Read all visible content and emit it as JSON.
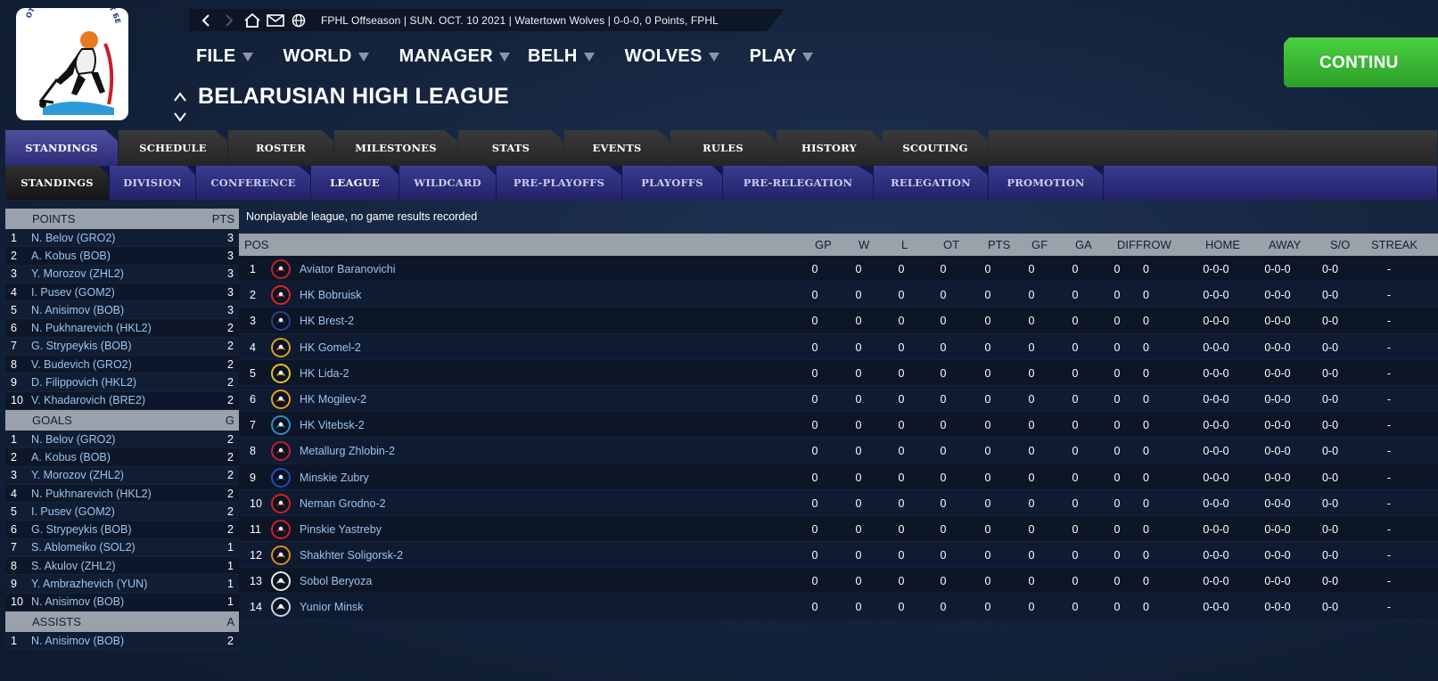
{
  "header": {
    "status_text": "FPHL Offseason | SUN. OCT. 10 2021 | Watertown Wolves | 0-0-0, 0 Points, FPHL",
    "league_title": "BELARUSIAN HIGH LEAGUE",
    "continue_label": "CONTINU",
    "menu": [
      "FILE",
      "WORLD",
      "MANAGER",
      "BELH",
      "WOLVES",
      "PLAY"
    ],
    "logo_text": "ОТКРЫТЫЙ ЧЕМПИОНАТ БЕЛАРУСИ"
  },
  "tabs_primary": [
    "STANDINGS",
    "SCHEDULE",
    "ROSTER",
    "MILESTONES",
    "STATS",
    "EVENTS",
    "RULES",
    "HISTORY",
    "SCOUTING"
  ],
  "tabs_secondary": [
    "STANDINGS",
    "DIVISION",
    "CONFERENCE",
    "LEAGUE",
    "WILDCARD",
    "PRE-PLAYOFFS",
    "PLAYOFFS",
    "PRE-RELEGATION",
    "RELEGATION",
    "PROMOTION"
  ],
  "leaders": {
    "points": {
      "title": "POINTS",
      "stat": "PTS",
      "rows": [
        {
          "rank": "1",
          "name": "N. Belov (GRO2)",
          "value": "3"
        },
        {
          "rank": "2",
          "name": "A. Kobus (BOB)",
          "value": "3"
        },
        {
          "rank": "3",
          "name": "Y. Morozov (ZHL2)",
          "value": "3"
        },
        {
          "rank": "4",
          "name": "I. Pusev (GOM2)",
          "value": "3"
        },
        {
          "rank": "5",
          "name": "N. Anisimov (BOB)",
          "value": "3"
        },
        {
          "rank": "6",
          "name": "N. Pukhnarevich (HKL2)",
          "value": "2"
        },
        {
          "rank": "7",
          "name": "G. Strypeykis (BOB)",
          "value": "2"
        },
        {
          "rank": "8",
          "name": "V. Budevich (GRO2)",
          "value": "2"
        },
        {
          "rank": "9",
          "name": "D. Filippovich (HKL2)",
          "value": "2"
        },
        {
          "rank": "10",
          "name": "V. Khadarovich (BRE2)",
          "value": "2"
        }
      ]
    },
    "goals": {
      "title": "GOALS",
      "stat": "G",
      "rows": [
        {
          "rank": "1",
          "name": "N. Belov (GRO2)",
          "value": "2"
        },
        {
          "rank": "2",
          "name": "A. Kobus (BOB)",
          "value": "2"
        },
        {
          "rank": "3",
          "name": "Y. Morozov (ZHL2)",
          "value": "2"
        },
        {
          "rank": "4",
          "name": "N. Pukhnarevich (HKL2)",
          "value": "2"
        },
        {
          "rank": "5",
          "name": "I. Pusev (GOM2)",
          "value": "2"
        },
        {
          "rank": "6",
          "name": "G. Strypeykis (BOB)",
          "value": "2"
        },
        {
          "rank": "7",
          "name": "S. Ablomeiko (SOL2)",
          "value": "1"
        },
        {
          "rank": "8",
          "name": "S. Akulov (ZHL2)",
          "value": "1"
        },
        {
          "rank": "9",
          "name": "Y. Ambrazhevich (YUN)",
          "value": "1"
        },
        {
          "rank": "10",
          "name": "N. Anisimov (BOB)",
          "value": "1"
        }
      ]
    },
    "assists": {
      "title": "ASSISTS",
      "stat": "A",
      "rows": [
        {
          "rank": "1",
          "name": "N. Anisimov (BOB)",
          "value": "2"
        }
      ]
    }
  },
  "standings": {
    "notice": "Nonplayable league, no game results recorded",
    "columns": [
      "POS",
      "GP",
      "W",
      "L",
      "OT",
      "PTS",
      "GF",
      "GA",
      "DIFF",
      "ROW",
      "HOME",
      "AWAY",
      "S/O",
      "STREAK"
    ],
    "rows": [
      {
        "pos": "1",
        "team": "Aviator Baranovichi",
        "logo": "red-star-plane",
        "color": "#c8202a"
      },
      {
        "pos": "2",
        "team": "HK Bobruisk",
        "logo": "beaver",
        "color": "#d8282a"
      },
      {
        "pos": "3",
        "team": "HK Brest-2",
        "logo": "bison",
        "color": "#2a3f8f"
      },
      {
        "pos": "4",
        "team": "HK Gomel-2",
        "logo": "wolf-head",
        "color": "#e0a020"
      },
      {
        "pos": "5",
        "team": "HK Lida-2",
        "logo": "shield-l",
        "color": "#e8c020"
      },
      {
        "pos": "6",
        "team": "HK Mogilev-2",
        "logo": "lion",
        "color": "#e8a020"
      },
      {
        "pos": "7",
        "team": "HK Vitebsk-2",
        "logo": "shark",
        "color": "#2a8fd0"
      },
      {
        "pos": "8",
        "team": "Metallurg Zhlobin-2",
        "logo": "wolf-crest",
        "color": "#c02030"
      },
      {
        "pos": "9",
        "team": "Minskie Zubry",
        "logo": "bison-circle",
        "color": "#1e4fb8"
      },
      {
        "pos": "10",
        "team": "Neman Grodno-2",
        "logo": "h-circle",
        "color": "#d02028"
      },
      {
        "pos": "11",
        "team": "Pinskie Yastreby",
        "logo": "hawk-wings",
        "color": "#d02030"
      },
      {
        "pos": "12",
        "team": "Shakhter Soligorsk-2",
        "logo": "miner",
        "color": "#e08a20"
      },
      {
        "pos": "13",
        "team": "Sobol Beryoza",
        "logo": "sable-circle",
        "color": "#e8e8e8"
      },
      {
        "pos": "14",
        "team": "Yunior Minsk",
        "logo": "round-crest",
        "color": "#c8d4e8"
      }
    ],
    "zero": "0",
    "record": "0-0-0",
    "so": "0-0",
    "streak": "-"
  },
  "colors": {
    "continue_green": "#3bbd34",
    "tab_active_blue": "#3a3a8a",
    "link_blue": "#9cc3ec",
    "header_gray": "#9aa1aa"
  }
}
